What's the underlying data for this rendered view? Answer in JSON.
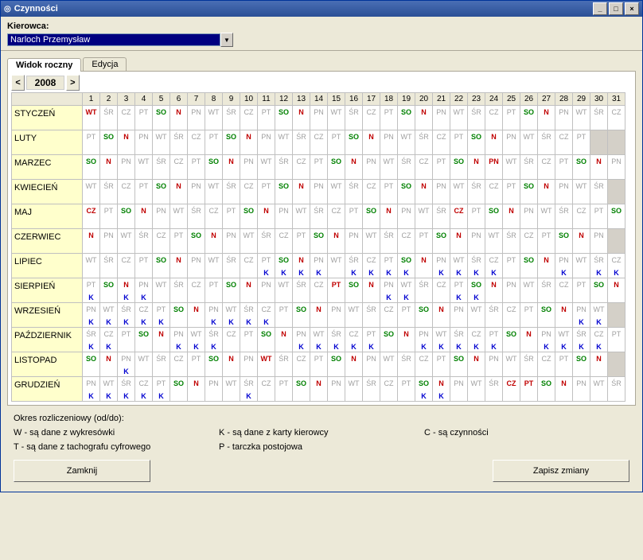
{
  "window": {
    "title": "Czynności"
  },
  "header": {
    "label": "Kierowca:",
    "driver": "Narloch Przemysław"
  },
  "tabs": {
    "view": "Widok roczny",
    "edit": "Edycja"
  },
  "nav": {
    "prev": "<",
    "next": ">",
    "year": "2008"
  },
  "days": [
    "1",
    "2",
    "3",
    "4",
    "5",
    "6",
    "7",
    "8",
    "9",
    "10",
    "11",
    "12",
    "13",
    "14",
    "15",
    "16",
    "17",
    "18",
    "19",
    "20",
    "21",
    "22",
    "23",
    "24",
    "25",
    "26",
    "27",
    "28",
    "29",
    "30",
    "31"
  ],
  "months": [
    "STYCZEŃ",
    "LUTY",
    "MARZEC",
    "KWIECIEŃ",
    "MAJ",
    "CZERWIEC",
    "LIPIEC",
    "SIERPIEŃ",
    "WRZESIEŃ",
    "PAŹDZIERNIK",
    "LISTOPAD",
    "GRUDZIEŃ"
  ],
  "legend": {
    "title": "Okres rozliczeniowy (od/do):",
    "w": "W - są dane z wykresówki",
    "t": "T - są dane z tachografu cyfrowego",
    "k": "K - są dane z karty kierowcy",
    "p": "P - tarczka postojowa",
    "c": "C - są czynności"
  },
  "buttons": {
    "close": "Zamknij",
    "save": "Zapisz zmiany"
  },
  "codes": {
    "WT": "WT",
    "SR": "ŚR",
    "CZ": "CZ",
    "PT": "PT",
    "SO": "SO",
    "N": "N",
    "PN": "PN",
    "K": "K"
  },
  "cal": [
    [
      [
        "WT",
        "r"
      ],
      [
        "ŚR",
        "g"
      ],
      [
        "CZ",
        "g"
      ],
      [
        "PT",
        "g"
      ],
      [
        "SO",
        "gr"
      ],
      [
        "N",
        "r"
      ],
      [
        "PN",
        "g"
      ],
      [
        "WT",
        "g"
      ],
      [
        "ŚR",
        "g"
      ],
      [
        "CZ",
        "g"
      ],
      [
        "PT",
        "g"
      ],
      [
        "SO",
        "gr"
      ],
      [
        "N",
        "r"
      ],
      [
        "PN",
        "g"
      ],
      [
        "WT",
        "g"
      ],
      [
        "ŚR",
        "g"
      ],
      [
        "CZ",
        "g"
      ],
      [
        "PT",
        "g"
      ],
      [
        "SO",
        "gr"
      ],
      [
        "N",
        "r"
      ],
      [
        "PN",
        "g"
      ],
      [
        "WT",
        "g"
      ],
      [
        "ŚR",
        "g"
      ],
      [
        "CZ",
        "g"
      ],
      [
        "PT",
        "g"
      ],
      [
        "SO",
        "gr"
      ],
      [
        "N",
        "r"
      ],
      [
        "PN",
        "g"
      ],
      [
        "WT",
        "g"
      ],
      [
        "ŚR",
        "g"
      ],
      [
        "CZ",
        "g"
      ]
    ],
    [
      [
        "PT",
        "g"
      ],
      [
        "SO",
        "gr"
      ],
      [
        "N",
        "r"
      ],
      [
        "PN",
        "g"
      ],
      [
        "WT",
        "g"
      ],
      [
        "ŚR",
        "g"
      ],
      [
        "CZ",
        "g"
      ],
      [
        "PT",
        "g"
      ],
      [
        "SO",
        "gr"
      ],
      [
        "N",
        "r"
      ],
      [
        "PN",
        "g"
      ],
      [
        "WT",
        "g"
      ],
      [
        "ŚR",
        "g"
      ],
      [
        "CZ",
        "g"
      ],
      [
        "PT",
        "g"
      ],
      [
        "SO",
        "gr"
      ],
      [
        "N",
        "r"
      ],
      [
        "PN",
        "g"
      ],
      [
        "WT",
        "g"
      ],
      [
        "ŚR",
        "g"
      ],
      [
        "CZ",
        "g"
      ],
      [
        "PT",
        "g"
      ],
      [
        "SO",
        "gr"
      ],
      [
        "N",
        "r"
      ],
      [
        "PN",
        "g"
      ],
      [
        "WT",
        "g"
      ],
      [
        "ŚR",
        "g"
      ],
      [
        "CZ",
        "g"
      ],
      [
        "PT",
        "g"
      ],
      [
        "",
        "x"
      ],
      [
        "",
        "x"
      ]
    ],
    [
      [
        "SO",
        "gr"
      ],
      [
        "N",
        "r"
      ],
      [
        "PN",
        "g"
      ],
      [
        "WT",
        "g"
      ],
      [
        "ŚR",
        "g"
      ],
      [
        "CZ",
        "g"
      ],
      [
        "PT",
        "g"
      ],
      [
        "SO",
        "gr"
      ],
      [
        "N",
        "r"
      ],
      [
        "PN",
        "g"
      ],
      [
        "WT",
        "g"
      ],
      [
        "ŚR",
        "g"
      ],
      [
        "CZ",
        "g"
      ],
      [
        "PT",
        "g"
      ],
      [
        "SO",
        "gr"
      ],
      [
        "N",
        "r"
      ],
      [
        "PN",
        "g"
      ],
      [
        "WT",
        "g"
      ],
      [
        "ŚR",
        "g"
      ],
      [
        "CZ",
        "g"
      ],
      [
        "PT",
        "g"
      ],
      [
        "SO",
        "gr"
      ],
      [
        "N",
        "r"
      ],
      [
        "PN",
        "r"
      ],
      [
        "WT",
        "g"
      ],
      [
        "ŚR",
        "g"
      ],
      [
        "CZ",
        "g"
      ],
      [
        "PT",
        "g"
      ],
      [
        "SO",
        "gr"
      ],
      [
        "N",
        "r"
      ],
      [
        "PN",
        "g"
      ]
    ],
    [
      [
        "WT",
        "g"
      ],
      [
        "ŚR",
        "g"
      ],
      [
        "CZ",
        "g"
      ],
      [
        "PT",
        "g"
      ],
      [
        "SO",
        "gr"
      ],
      [
        "N",
        "r"
      ],
      [
        "PN",
        "g"
      ],
      [
        "WT",
        "g"
      ],
      [
        "ŚR",
        "g"
      ],
      [
        "CZ",
        "g"
      ],
      [
        "PT",
        "g"
      ],
      [
        "SO",
        "gr"
      ],
      [
        "N",
        "r"
      ],
      [
        "PN",
        "g"
      ],
      [
        "WT",
        "g"
      ],
      [
        "ŚR",
        "g"
      ],
      [
        "CZ",
        "g"
      ],
      [
        "PT",
        "g"
      ],
      [
        "SO",
        "gr"
      ],
      [
        "N",
        "r"
      ],
      [
        "PN",
        "g"
      ],
      [
        "WT",
        "g"
      ],
      [
        "ŚR",
        "g"
      ],
      [
        "CZ",
        "g"
      ],
      [
        "PT",
        "g"
      ],
      [
        "SO",
        "gr"
      ],
      [
        "N",
        "r"
      ],
      [
        "PN",
        "g"
      ],
      [
        "WT",
        "g"
      ],
      [
        "ŚR",
        "g"
      ],
      [
        "",
        "x"
      ]
    ],
    [
      [
        "CZ",
        "r"
      ],
      [
        "PT",
        "g"
      ],
      [
        "SO",
        "gr"
      ],
      [
        "N",
        "r"
      ],
      [
        "PN",
        "g"
      ],
      [
        "WT",
        "g"
      ],
      [
        "ŚR",
        "g"
      ],
      [
        "CZ",
        "g"
      ],
      [
        "PT",
        "g"
      ],
      [
        "SO",
        "gr"
      ],
      [
        "N",
        "r"
      ],
      [
        "PN",
        "g"
      ],
      [
        "WT",
        "g"
      ],
      [
        "ŚR",
        "g"
      ],
      [
        "CZ",
        "g"
      ],
      [
        "PT",
        "g"
      ],
      [
        "SO",
        "gr"
      ],
      [
        "N",
        "r"
      ],
      [
        "PN",
        "g"
      ],
      [
        "WT",
        "g"
      ],
      [
        "ŚR",
        "g"
      ],
      [
        "CZ",
        "r"
      ],
      [
        "PT",
        "g"
      ],
      [
        "SO",
        "gr"
      ],
      [
        "N",
        "r"
      ],
      [
        "PN",
        "g"
      ],
      [
        "WT",
        "g"
      ],
      [
        "ŚR",
        "g"
      ],
      [
        "CZ",
        "g"
      ],
      [
        "PT",
        "g"
      ],
      [
        "SO",
        "gr"
      ]
    ],
    [
      [
        "N",
        "r"
      ],
      [
        "PN",
        "g"
      ],
      [
        "WT",
        "g"
      ],
      [
        "ŚR",
        "g"
      ],
      [
        "CZ",
        "g"
      ],
      [
        "PT",
        "g"
      ],
      [
        "SO",
        "gr"
      ],
      [
        "N",
        "r"
      ],
      [
        "PN",
        "g"
      ],
      [
        "WT",
        "g"
      ],
      [
        "ŚR",
        "g"
      ],
      [
        "CZ",
        "g"
      ],
      [
        "PT",
        "g"
      ],
      [
        "SO",
        "gr"
      ],
      [
        "N",
        "r"
      ],
      [
        "PN",
        "g"
      ],
      [
        "WT",
        "g"
      ],
      [
        "ŚR",
        "g"
      ],
      [
        "CZ",
        "g"
      ],
      [
        "PT",
        "g"
      ],
      [
        "SO",
        "gr"
      ],
      [
        "N",
        "r"
      ],
      [
        "PN",
        "g"
      ],
      [
        "WT",
        "g"
      ],
      [
        "ŚR",
        "g"
      ],
      [
        "CZ",
        "g"
      ],
      [
        "PT",
        "g"
      ],
      [
        "SO",
        "gr"
      ],
      [
        "N",
        "r"
      ],
      [
        "PN",
        "g"
      ],
      [
        "",
        "x"
      ]
    ],
    [
      [
        "WT",
        "g"
      ],
      [
        "ŚR",
        "g"
      ],
      [
        "CZ",
        "g"
      ],
      [
        "PT",
        "g"
      ],
      [
        "SO",
        "gr"
      ],
      [
        "N",
        "r"
      ],
      [
        "PN",
        "g"
      ],
      [
        "WT",
        "g"
      ],
      [
        "ŚR",
        "g"
      ],
      [
        "CZ",
        "g"
      ],
      [
        "PT",
        "g",
        "K"
      ],
      [
        "SO",
        "gr",
        "K"
      ],
      [
        "N",
        "r",
        "K"
      ],
      [
        "PN",
        "g",
        "K"
      ],
      [
        "WT",
        "g"
      ],
      [
        "ŚR",
        "g",
        "K"
      ],
      [
        "CZ",
        "g",
        "K"
      ],
      [
        "PT",
        "g",
        "K"
      ],
      [
        "SO",
        "gr",
        "K"
      ],
      [
        "N",
        "r"
      ],
      [
        "PN",
        "g",
        "K"
      ],
      [
        "WT",
        "g",
        "K"
      ],
      [
        "ŚR",
        "g",
        "K"
      ],
      [
        "CZ",
        "g",
        "K"
      ],
      [
        "PT",
        "g"
      ],
      [
        "SO",
        "gr"
      ],
      [
        "N",
        "r"
      ],
      [
        "PN",
        "g",
        "K"
      ],
      [
        "WT",
        "g"
      ],
      [
        "ŚR",
        "g",
        "K"
      ],
      [
        "CZ",
        "g",
        "K"
      ]
    ],
    [
      [
        "PT",
        "g",
        "K"
      ],
      [
        "SO",
        "gr"
      ],
      [
        "N",
        "r",
        "K"
      ],
      [
        "PN",
        "g",
        "K"
      ],
      [
        "WT",
        "g"
      ],
      [
        "ŚR",
        "g"
      ],
      [
        "CZ",
        "g"
      ],
      [
        "PT",
        "g"
      ],
      [
        "SO",
        "gr"
      ],
      [
        "N",
        "r"
      ],
      [
        "PN",
        "g"
      ],
      [
        "WT",
        "g"
      ],
      [
        "ŚR",
        "g"
      ],
      [
        "CZ",
        "g"
      ],
      [
        "PT",
        "r"
      ],
      [
        "SO",
        "gr"
      ],
      [
        "N",
        "r"
      ],
      [
        "PN",
        "g",
        "K"
      ],
      [
        "WT",
        "g",
        "K"
      ],
      [
        "ŚR",
        "g"
      ],
      [
        "CZ",
        "g"
      ],
      [
        "PT",
        "g",
        "K"
      ],
      [
        "SO",
        "gr",
        "K"
      ],
      [
        "N",
        "r"
      ],
      [
        "PN",
        "g"
      ],
      [
        "WT",
        "g"
      ],
      [
        "ŚR",
        "g"
      ],
      [
        "CZ",
        "g"
      ],
      [
        "PT",
        "g"
      ],
      [
        "SO",
        "gr"
      ],
      [
        "N",
        "r"
      ]
    ],
    [
      [
        "PN",
        "g",
        "K"
      ],
      [
        "WT",
        "g",
        "K"
      ],
      [
        "ŚR",
        "g",
        "K"
      ],
      [
        "CZ",
        "g",
        "K"
      ],
      [
        "PT",
        "g",
        "K"
      ],
      [
        "SO",
        "gr"
      ],
      [
        "N",
        "r"
      ],
      [
        "PN",
        "g",
        "K"
      ],
      [
        "WT",
        "g",
        "K"
      ],
      [
        "ŚR",
        "g",
        "K"
      ],
      [
        "CZ",
        "g",
        "K"
      ],
      [
        "PT",
        "g"
      ],
      [
        "SO",
        "gr"
      ],
      [
        "N",
        "r"
      ],
      [
        "PN",
        "g"
      ],
      [
        "WT",
        "g"
      ],
      [
        "ŚR",
        "g"
      ],
      [
        "CZ",
        "g"
      ],
      [
        "PT",
        "g"
      ],
      [
        "SO",
        "gr"
      ],
      [
        "N",
        "r"
      ],
      [
        "PN",
        "g"
      ],
      [
        "WT",
        "g"
      ],
      [
        "ŚR",
        "g"
      ],
      [
        "CZ",
        "g"
      ],
      [
        "PT",
        "g"
      ],
      [
        "SO",
        "gr"
      ],
      [
        "N",
        "r"
      ],
      [
        "PN",
        "g",
        "K"
      ],
      [
        "WT",
        "g",
        "K"
      ],
      [
        "",
        "x"
      ]
    ],
    [
      [
        "ŚR",
        "g",
        "K"
      ],
      [
        "CZ",
        "g",
        "K"
      ],
      [
        "PT",
        "g"
      ],
      [
        "SO",
        "gr"
      ],
      [
        "N",
        "r"
      ],
      [
        "PN",
        "g",
        "K"
      ],
      [
        "WT",
        "g",
        "K"
      ],
      [
        "ŚR",
        "g",
        "K"
      ],
      [
        "CZ",
        "g"
      ],
      [
        "PT",
        "g"
      ],
      [
        "SO",
        "gr"
      ],
      [
        "N",
        "r"
      ],
      [
        "PN",
        "g",
        "K"
      ],
      [
        "WT",
        "g",
        "K"
      ],
      [
        "ŚR",
        "g",
        "K"
      ],
      [
        "CZ",
        "g",
        "K"
      ],
      [
        "PT",
        "g",
        "K"
      ],
      [
        "SO",
        "gr"
      ],
      [
        "N",
        "r"
      ],
      [
        "PN",
        "g",
        "K"
      ],
      [
        "WT",
        "g",
        "K"
      ],
      [
        "ŚR",
        "g",
        "K"
      ],
      [
        "CZ",
        "g",
        "K"
      ],
      [
        "PT",
        "g",
        "K"
      ],
      [
        "SO",
        "gr"
      ],
      [
        "N",
        "r"
      ],
      [
        "PN",
        "g",
        "K"
      ],
      [
        "WT",
        "g",
        "K"
      ],
      [
        "ŚR",
        "g",
        "K"
      ],
      [
        "CZ",
        "g",
        "K"
      ],
      [
        "PT",
        "g"
      ]
    ],
    [
      [
        "SO",
        "gr"
      ],
      [
        "N",
        "r"
      ],
      [
        "PN",
        "g",
        "K"
      ],
      [
        "WT",
        "g"
      ],
      [
        "ŚR",
        "g"
      ],
      [
        "CZ",
        "g"
      ],
      [
        "PT",
        "g"
      ],
      [
        "SO",
        "gr"
      ],
      [
        "N",
        "r"
      ],
      [
        "PN",
        "g"
      ],
      [
        "WT",
        "r"
      ],
      [
        "ŚR",
        "g"
      ],
      [
        "CZ",
        "g"
      ],
      [
        "PT",
        "g"
      ],
      [
        "SO",
        "gr"
      ],
      [
        "N",
        "r"
      ],
      [
        "PN",
        "g"
      ],
      [
        "WT",
        "g"
      ],
      [
        "ŚR",
        "g"
      ],
      [
        "CZ",
        "g"
      ],
      [
        "PT",
        "g"
      ],
      [
        "SO",
        "gr"
      ],
      [
        "N",
        "r"
      ],
      [
        "PN",
        "g"
      ],
      [
        "WT",
        "g"
      ],
      [
        "ŚR",
        "g"
      ],
      [
        "CZ",
        "g"
      ],
      [
        "PT",
        "g"
      ],
      [
        "SO",
        "gr"
      ],
      [
        "N",
        "r"
      ],
      [
        "",
        "x"
      ]
    ],
    [
      [
        "PN",
        "g",
        "K"
      ],
      [
        "WT",
        "g",
        "K"
      ],
      [
        "ŚR",
        "g",
        "K"
      ],
      [
        "CZ",
        "g",
        "K"
      ],
      [
        "PT",
        "g",
        "K"
      ],
      [
        "SO",
        "gr"
      ],
      [
        "N",
        "r"
      ],
      [
        "PN",
        "g"
      ],
      [
        "WT",
        "g"
      ],
      [
        "ŚR",
        "g",
        "K"
      ],
      [
        "CZ",
        "g"
      ],
      [
        "PT",
        "g"
      ],
      [
        "SO",
        "gr"
      ],
      [
        "N",
        "r"
      ],
      [
        "PN",
        "g"
      ],
      [
        "WT",
        "g"
      ],
      [
        "ŚR",
        "g"
      ],
      [
        "CZ",
        "g"
      ],
      [
        "PT",
        "g"
      ],
      [
        "SO",
        "gr",
        "K"
      ],
      [
        "N",
        "r",
        "K"
      ],
      [
        "PN",
        "g"
      ],
      [
        "WT",
        "g"
      ],
      [
        "ŚR",
        "g"
      ],
      [
        "CZ",
        "r"
      ],
      [
        "PT",
        "r"
      ],
      [
        "SO",
        "gr"
      ],
      [
        "N",
        "r"
      ],
      [
        "PN",
        "g"
      ],
      [
        "WT",
        "g"
      ],
      [
        "ŚR",
        "g"
      ]
    ]
  ]
}
